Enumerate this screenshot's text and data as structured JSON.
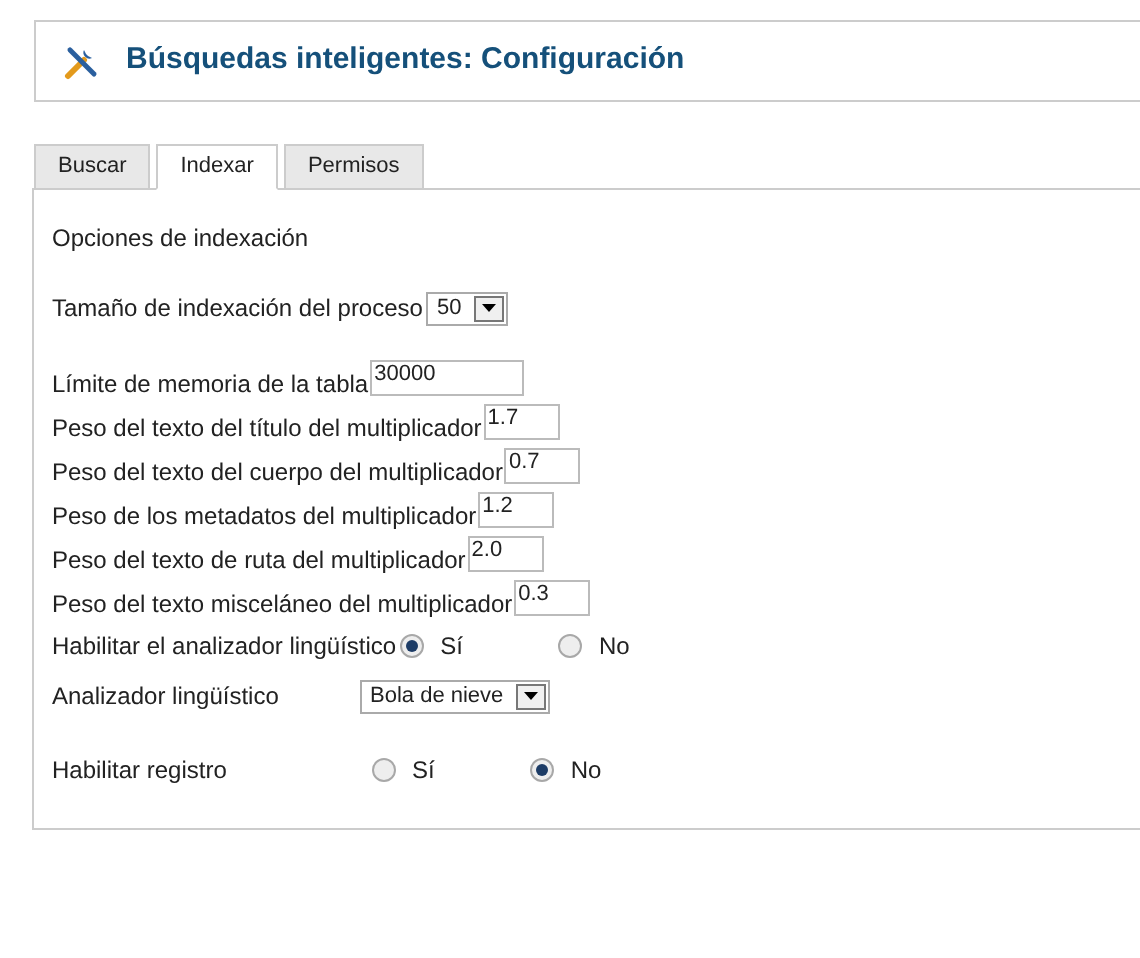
{
  "title": "Búsquedas inteligentes: Configuración",
  "tabs": [
    {
      "label": "Buscar",
      "selected": false
    },
    {
      "label": "Indexar",
      "selected": true
    },
    {
      "label": "Permisos",
      "selected": false
    }
  ],
  "section_title": "Opciones de indexación",
  "fields": [
    {
      "kind": "select",
      "label": "Tamaño de indexación del proceso",
      "value": "50"
    },
    {
      "kind": "text",
      "label": "Límite de memoria de la tabla",
      "value": "30000"
    },
    {
      "kind": "text",
      "label": "Peso del texto del título del multiplicador",
      "value": "1.7"
    },
    {
      "kind": "text",
      "label": "Peso del texto del cuerpo del multiplicador",
      "value": "0.7"
    },
    {
      "kind": "text",
      "label": "Peso de los metadatos del multiplicador",
      "value": "1.2"
    },
    {
      "kind": "text",
      "label": "Peso del texto de ruta del multiplicador",
      "value": "2.0"
    },
    {
      "kind": "text",
      "label": "Peso del texto misceláneo del multiplicador",
      "value": "0.3"
    },
    {
      "kind": "radio",
      "label": "Habilitar el analizador lingüístico",
      "options": [
        {
          "label": "Sí",
          "selected": true
        },
        {
          "label": "No",
          "selected": false
        }
      ]
    },
    {
      "kind": "select",
      "label": "Analizador lingüístico",
      "value": "Bola de nieve"
    },
    {
      "kind": "radio",
      "label": "Habilitar registro",
      "options": [
        {
          "label": "Sí",
          "selected": false
        },
        {
          "label": "No",
          "selected": true
        }
      ]
    }
  ]
}
